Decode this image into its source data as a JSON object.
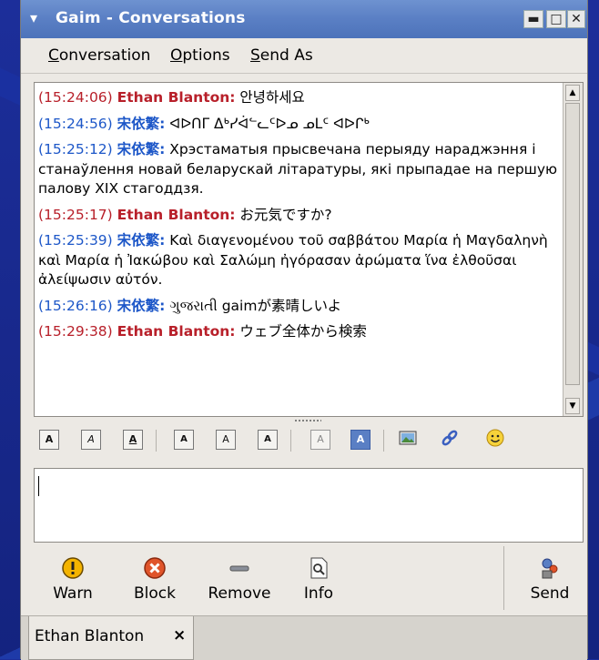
{
  "window": {
    "title": "Gaim - Conversations",
    "menu_arrow": "▾",
    "minimize": "▬",
    "maximize": "□",
    "close": "✕"
  },
  "menubar": {
    "conversation": {
      "first": "C",
      "rest": "onversation"
    },
    "options": {
      "first": "O",
      "rest": "ptions"
    },
    "sendas": {
      "first": "S",
      "rest": "end As"
    }
  },
  "messages": [
    {
      "ts": "(15:24:06)",
      "name": "Ethan Blanton:",
      "text": " 안녕하세요",
      "color": "red"
    },
    {
      "ts": "(15:24:56)",
      "name": "宋依繁:",
      "text": " ᐊᐅᑎᒥ ᐃᒃᓯᐋᓪᓚᑦᐅᓄ ᓄᒪᑦ ᐊᐅᒋᒃ",
      "color": "blue"
    },
    {
      "ts": "(15:25:12)",
      "name": "宋依繁:",
      "text": " Хрэстаматыя прысвечана перыяду нараджэння і станаўлення новай беларускай літаратуры, які прыпадае на першую палову XIX стагоддзя.",
      "color": "blue"
    },
    {
      "ts": "(15:25:17)",
      "name": "Ethan Blanton:",
      "text": " お元気ですか?",
      "color": "red"
    },
    {
      "ts": "(15:25:39)",
      "name": "宋依繁:",
      "text": " Καὶ διαγενομένου τοῦ σαββάτου Μαρία ἡ Μαγδαληνὴ καὶ Μαρία ἡ Ἰακώβου καὶ Σαλώμη ἠγόρασαν ἀρώματα ἵνα ἐλθοῦσαι ἀλείψωσιν αὐτόν.",
      "color": "blue"
    },
    {
      "ts": "(15:26:16)",
      "name": "宋依繁:",
      "text": " ગુજરાતી gaimが素晴しいよ",
      "color": "blue"
    },
    {
      "ts": "(15:29:38)",
      "name": "Ethan Blanton:",
      "text": " ウェブ全体から検索",
      "color": "red"
    }
  ],
  "format_toolbar": {
    "bold": "A",
    "italic": "A",
    "underline": "A",
    "font_grow": "A",
    "font_normal": "A",
    "font_shrink": "A",
    "fg_color": "A",
    "bg_color": "A"
  },
  "colors": {
    "titlebar": "#5a7fc4",
    "self_name": "#b8202a",
    "buddy_name": "#1d57c8"
  },
  "actions": {
    "warn": "Warn",
    "block": "Block",
    "remove": "Remove",
    "info": "Info",
    "send": "Send"
  },
  "tab": {
    "name": "Ethan Blanton",
    "close": "×"
  }
}
